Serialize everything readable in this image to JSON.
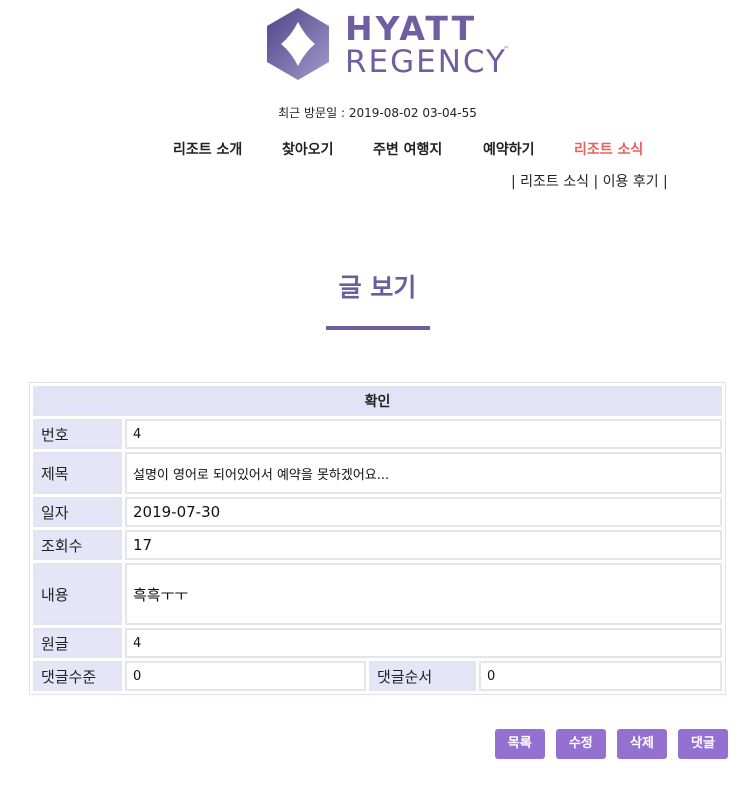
{
  "logo": {
    "line1": "HYATT",
    "line2": "REGENCY",
    "tm": "™"
  },
  "visit": "최근 방문일 : 2019-08-02 03-04-55",
  "nav": {
    "items": [
      "리조트 소개",
      "찾아오기",
      "주변 여행지",
      "예약하기",
      "리조트 소식"
    ],
    "active_index": 4,
    "active_color": "#e8605a"
  },
  "subnav": "| 리조트 소식 | 이용 후기 |",
  "page_title": "글 보기",
  "table": {
    "header": "확인",
    "rows": [
      {
        "label": "번호",
        "value": "4"
      },
      {
        "label": "제목",
        "value": "설명이 영어로 되어있어서 예약을 못하겠어요..."
      },
      {
        "label": "일자",
        "value": "2019-07-30"
      },
      {
        "label": "조회수",
        "value": "17"
      },
      {
        "label": "내용",
        "value": "흑흑ㅜㅜ"
      },
      {
        "label": "원글",
        "value": "4"
      }
    ],
    "reply_level_label": "댓글수준",
    "reply_level_value": "0",
    "reply_order_label": "댓글순서",
    "reply_order_value": "0"
  },
  "buttons": {
    "list": "목록",
    "edit": "수정",
    "delete": "삭제",
    "reply": "댓글"
  },
  "colors": {
    "accent": "#9471d1",
    "brand": "#6f5fa0",
    "label_bg": "#e6e5f7"
  }
}
